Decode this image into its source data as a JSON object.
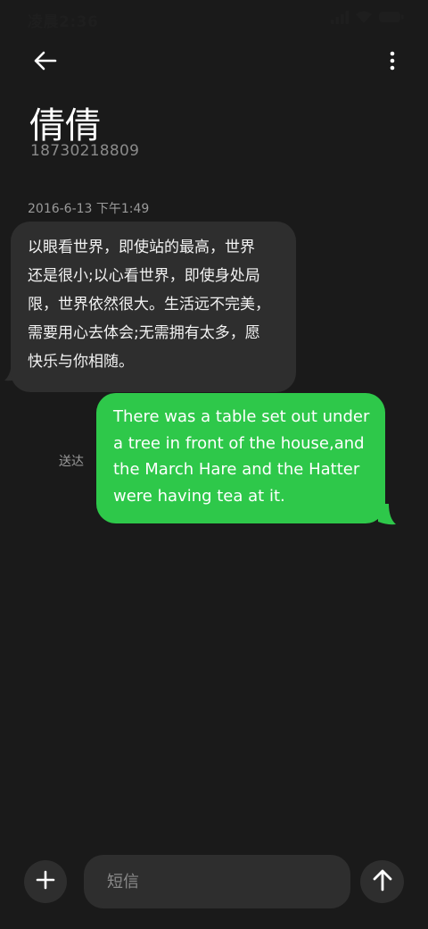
{
  "status_bar": {
    "time": "凌晨2:36",
    "icons": [
      "signal-icon",
      "wifi-icon",
      "battery-icon"
    ]
  },
  "header": {
    "back_icon": "arrow-left-icon",
    "more_icon": "more-vertical-icon"
  },
  "contact": {
    "name": "倩倩",
    "number": "18730218809"
  },
  "conversation": {
    "timestamp": "2016-6-13 下午1:49",
    "incoming": {
      "lines": [
        "以眼看世界，即使站的最高，世界",
        "还是很小;以心看世界，即使身处局",
        "限，世界依然很大。生活远不完美，",
        "需要用心去体会;无需拥有太多，愿",
        "快乐与你相随。"
      ]
    },
    "outgoing": {
      "lines": [
        "There was a table set out under",
        "a tree in front of the house,and",
        "the March Hare and the Hatter",
        "were having tea at it."
      ],
      "status": "送达"
    }
  },
  "composer": {
    "placeholder": "短信",
    "add_icon": "plus-icon",
    "send_icon": "arrow-up-icon"
  },
  "colors": {
    "background": "#1a1a1a",
    "incoming_bubble": "#2e2e2e",
    "outgoing_bubble": "#2ec84a",
    "secondary_text": "#8a8a8a"
  }
}
